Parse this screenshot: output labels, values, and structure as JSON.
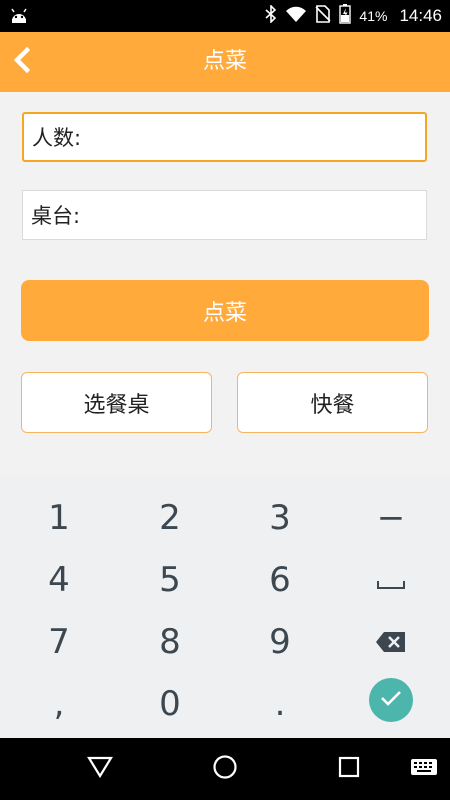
{
  "status_bar": {
    "battery_percent": "41%",
    "time": "14:46",
    "icons": [
      "android-icon",
      "bluetooth-icon",
      "wifi-icon",
      "no-sim-icon",
      "battery-charging-icon"
    ]
  },
  "header": {
    "title": "点菜",
    "back_icon": "chevron-left-icon"
  },
  "form": {
    "people_label": "人数:",
    "table_label": "桌台:"
  },
  "buttons": {
    "order": "点菜",
    "choose_table": "选餐桌",
    "fast_food": "快餐"
  },
  "keyboard": {
    "row1": [
      "1",
      "2",
      "3",
      "−"
    ],
    "row2": [
      "4",
      "5",
      "6"
    ],
    "row3": [
      "7",
      "8",
      "9"
    ],
    "row4": [
      ",",
      "0",
      "."
    ],
    "special_icons": [
      "space-icon",
      "backspace-icon",
      "check-icon"
    ]
  },
  "colors": {
    "accent": "#FFAA3B",
    "focus_border": "#F5A623",
    "enter_key": "#4DB6AC",
    "key_text": "#3C4750"
  }
}
